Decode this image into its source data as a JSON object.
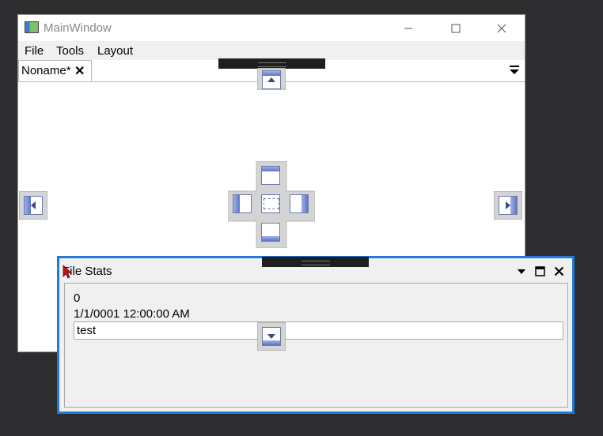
{
  "window": {
    "title": "MainWindow"
  },
  "menu": {
    "items": [
      "File",
      "Tools",
      "Layout"
    ]
  },
  "document_tab": {
    "label": "Noname*"
  },
  "tool_window": {
    "title": "File Stats",
    "count_value": "0",
    "date_value": "1/1/0001 12:00:00 AM",
    "text_value": "test"
  },
  "icons": {
    "app": "app-icon",
    "minimize": "minimize-icon",
    "maximize": "maximize-icon",
    "close": "close-icon",
    "tab_close": "close-icon",
    "tab_menu": "dropdown-icon",
    "tool_menu": "chevron-down-icon",
    "tool_maximize": "maximize-icon",
    "tool_close": "close-icon",
    "cursor": "mouse-pointer-icon"
  },
  "colors": {
    "accent": "#1f7ad8",
    "background": "#2d2d30",
    "dock_blue": "#5f74c4"
  }
}
